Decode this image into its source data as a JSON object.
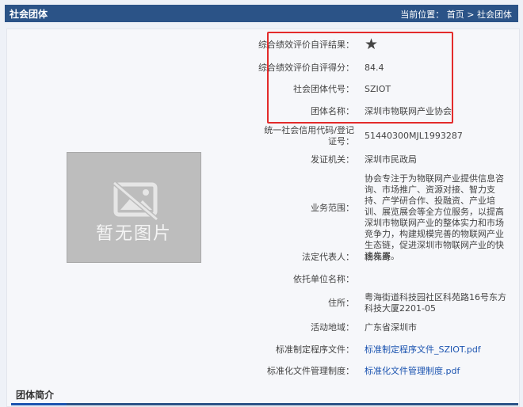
{
  "header": {
    "title": "社会团体",
    "breadcrumb_prefix": "当前位置：",
    "home": "首页",
    "sep": ">",
    "current": "社会团体"
  },
  "placeholder": {
    "text": "暂无图片"
  },
  "fields": [
    {
      "label": "综合绩效评价自评结果：",
      "value": "★",
      "icon": "star-icon"
    },
    {
      "label": "综合绩效评价自评得分：",
      "value": "84.4"
    },
    {
      "label": "社会团体代号：",
      "value": "SZIOT"
    },
    {
      "label": "团体名称：",
      "value": "深圳市物联网产业协会"
    },
    {
      "label": "统一社会信用代码/登记证号：",
      "value": "51440300MJL1993287"
    },
    {
      "label": "发证机关：",
      "value": "深圳市民政局"
    },
    {
      "label": "业务范围：",
      "value": "协会专注于为物联网产业提供信息咨询、市场推广、资源对接、智力支持、产学研合作、投融资、产业培训、展览展会等全方位服务，以提高深圳市物联网产业的整体实力和市场竞争力，构建规模完善的物联网产业生态链，促进深圳市物联网产业的快速发展。"
    },
    {
      "label": "法定代表人：",
      "value": "杨伟奇"
    },
    {
      "label": "依托单位名称：",
      "value": ""
    },
    {
      "label": "住所：",
      "value": "粤海街道科技园社区科苑路16号东方科技大厦2201-05"
    },
    {
      "label": "活动地域：",
      "value": "广东省深圳市"
    },
    {
      "label": "标准制定程序文件：",
      "value": "标准制定程序文件_SZIOT.pdf"
    },
    {
      "label": "标准化文件管理制度：",
      "value": "标准化文件管理制度.pdf"
    }
  ],
  "intro": {
    "title": "团体简介"
  },
  "colors": {
    "header": "#2b5387",
    "highlight": "#e32b2b",
    "link": "#1c54b0",
    "star": "#c9a45c"
  }
}
